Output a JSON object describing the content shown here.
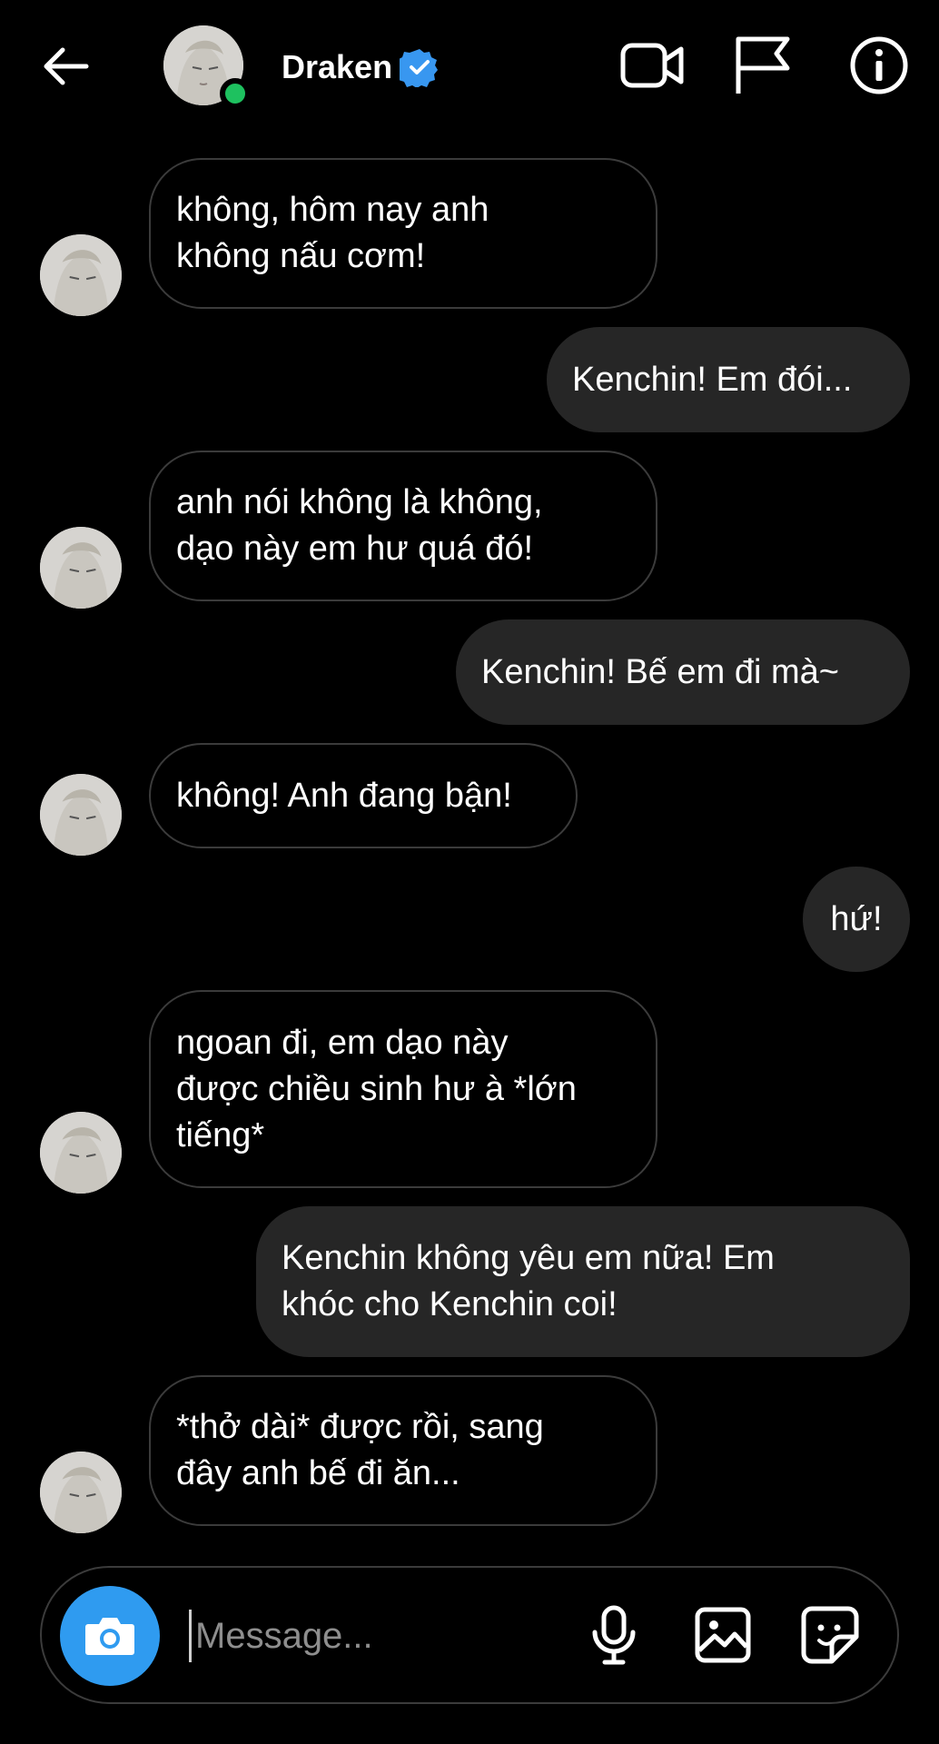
{
  "header": {
    "name": "Draken",
    "online": true,
    "verified": true
  },
  "messages": [
    {
      "from": "them",
      "text": "không, hôm nay anh\nkhông nấu cơm!"
    },
    {
      "from": "me",
      "text": "Kenchin! Em đói..."
    },
    {
      "from": "them",
      "text": "anh nói không là không,\ndạo này em hư quá đó!"
    },
    {
      "from": "me",
      "text": "Kenchin! Bế em đi mà~"
    },
    {
      "from": "them",
      "text": "không! Anh đang bận!"
    },
    {
      "from": "me",
      "text": "hứ!"
    },
    {
      "from": "them",
      "text": "ngoan đi, em dạo này\nđược chiều sinh hư à *lớn\ntiếng*"
    },
    {
      "from": "me",
      "text": "Kenchin không yêu em nữa! Em\nkhóc cho Kenchin coi!"
    },
    {
      "from": "them",
      "text": "*thở dài* được rồi, sang\nđây anh bế đi ăn..."
    }
  ],
  "composer": {
    "placeholder": "Message..."
  },
  "colors": {
    "background": "#000000",
    "outgoing_bubble": "#262626",
    "incoming_border": "#3b3b3b",
    "camera_button": "#2f9bf0",
    "online_dot": "#1ec15f",
    "verified_badge": "#3897f0"
  },
  "icons": {
    "back": "arrow-left-icon",
    "video": "video-camera-icon",
    "flag": "flag-icon",
    "info": "info-icon",
    "camera": "camera-icon",
    "mic": "microphone-icon",
    "gallery": "image-icon",
    "sticker": "sticker-icon"
  }
}
